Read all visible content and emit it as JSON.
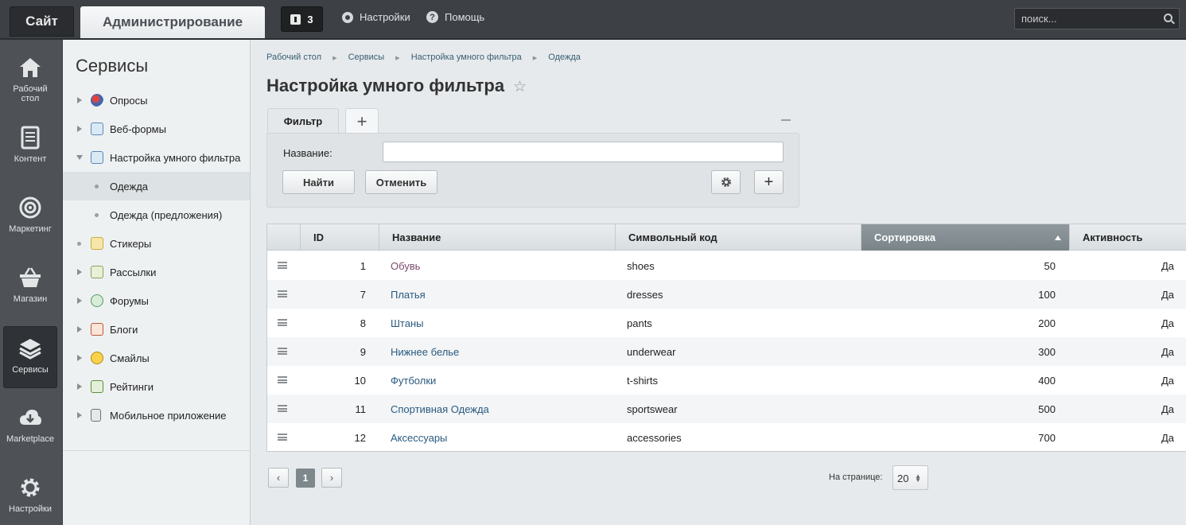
{
  "topbar": {
    "site_tab": "Сайт",
    "admin_tab": "Администрирование",
    "notifications_count": "3",
    "settings_label": "Настройки",
    "help_label": "Помощь",
    "search_placeholder": "поиск..."
  },
  "iconbar": {
    "items": [
      {
        "label": "Рабочий стол",
        "icon": "home-icon"
      },
      {
        "label": "Контент",
        "icon": "document-icon"
      },
      {
        "label": "Маркетинг",
        "icon": "target-icon"
      },
      {
        "label": "Магазин",
        "icon": "basket-icon"
      },
      {
        "label": "Сервисы",
        "icon": "layers-icon"
      },
      {
        "label": "Marketplace",
        "icon": "cloud-download-icon"
      },
      {
        "label": "Настройки",
        "icon": "gear-icon"
      }
    ]
  },
  "sidebar": {
    "title": "Сервисы",
    "items": [
      {
        "label": "Опросы"
      },
      {
        "label": "Веб-формы"
      },
      {
        "label": "Настройка умного фильтра"
      },
      {
        "label": "Одежда"
      },
      {
        "label": "Одежда (предложения)"
      },
      {
        "label": "Стикеры"
      },
      {
        "label": "Рассылки"
      },
      {
        "label": "Форумы"
      },
      {
        "label": "Блоги"
      },
      {
        "label": "Смайлы"
      },
      {
        "label": "Рейтинги"
      },
      {
        "label": "Мобильное приложение"
      }
    ]
  },
  "breadcrumb": [
    "Рабочий стол",
    "Сервисы",
    "Настройка умного фильтра",
    "Одежда"
  ],
  "page": {
    "title": "Настройка умного фильтра"
  },
  "filter": {
    "tab_label": "Фильтр",
    "name_label": "Название:",
    "name_value": "",
    "find_button": "Найти",
    "cancel_button": "Отменить"
  },
  "table": {
    "columns": [
      "ID",
      "Название",
      "Символьный код",
      "Сортировка",
      "Активность"
    ],
    "sorted_column": "Сортировка",
    "rows": [
      {
        "id": "1",
        "name": "Обувь",
        "code": "shoes",
        "sort": "50",
        "active": "Да"
      },
      {
        "id": "7",
        "name": "Платья",
        "code": "dresses",
        "sort": "100",
        "active": "Да"
      },
      {
        "id": "8",
        "name": "Штаны",
        "code": "pants",
        "sort": "200",
        "active": "Да"
      },
      {
        "id": "9",
        "name": "Нижнее белье",
        "code": "underwear",
        "sort": "300",
        "active": "Да"
      },
      {
        "id": "10",
        "name": "Футболки",
        "code": "t-shirts",
        "sort": "400",
        "active": "Да"
      },
      {
        "id": "11",
        "name": "Спортивная Одежда",
        "code": "sportswear",
        "sort": "500",
        "active": "Да"
      },
      {
        "id": "12",
        "name": "Аксессуары",
        "code": "accessories",
        "sort": "700",
        "active": "Да"
      }
    ]
  },
  "pagination": {
    "current_page": "1",
    "per_page_label": "На странице:",
    "per_page_value": "20"
  },
  "colors": {
    "accent": "#2a5a80",
    "sorted_header": "#7a8489",
    "topbar": "#3d4145"
  }
}
